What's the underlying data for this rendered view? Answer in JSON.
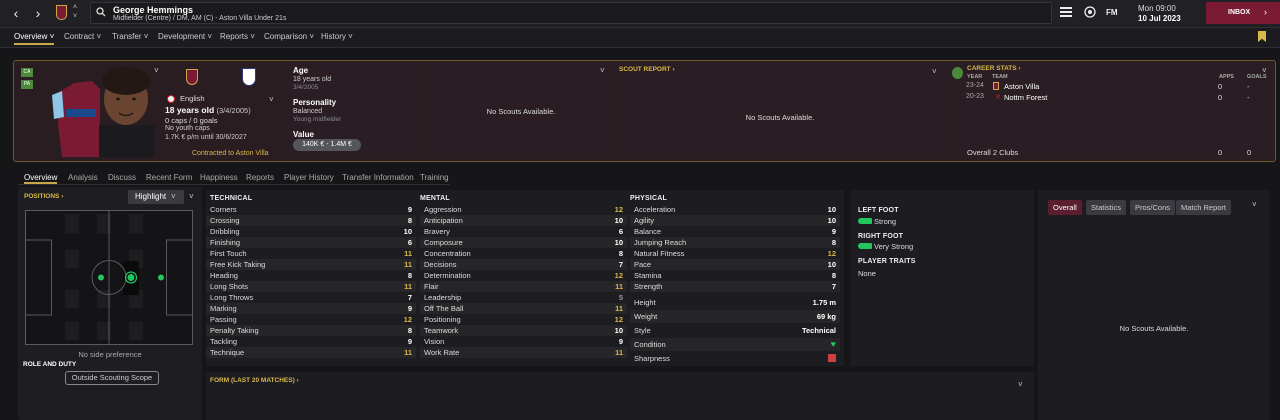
{
  "topbar": {
    "player_name": "George Hemmings",
    "player_subtitle": "Midfielder (Centre) / DM, AM (C) - Aston Villa Under 21s",
    "fm_label": "FM",
    "date_day": "Mon 09:00",
    "date": "10 Jul 2023",
    "inbox_label": "INBOX",
    "accent_color": "#7a1b33"
  },
  "menu": [
    {
      "label": "Overview"
    },
    {
      "label": "Contract"
    },
    {
      "label": "Transfer"
    },
    {
      "label": "Development"
    },
    {
      "label": "Reports"
    },
    {
      "label": "Comparison"
    },
    {
      "label": "History"
    }
  ],
  "profile": {
    "badge_a": "CA",
    "badge_b": "PA",
    "nationality": "English",
    "age_line": "18 years old",
    "dob_paren": "(3/4/2005)",
    "caps_line": "0 caps / 0 goals",
    "youth_caps": "No youth caps",
    "wage": "1.7K € p/m until 30/6/2027",
    "contract_note": "Contracted to Aston Villa",
    "age_label": "Age",
    "age_value": "18 years old",
    "dob": "3/4/2005",
    "personality_label": "Personality",
    "personality": "Balanced",
    "personality_sub": "Young midfielder",
    "value_label": "Value",
    "value": "140K € - 1.4M €"
  },
  "scouts": {
    "no_scouts": "No Scouts Available.",
    "scout_report_link": "SCOUT REPORT",
    "no_scouts2": "No Scouts Available."
  },
  "career": {
    "title": "CAREER STATS",
    "col_year": "YEAR",
    "col_team": "TEAM",
    "col_apps": "APPS",
    "col_goals": "GOALS",
    "rows": [
      {
        "year": "23-24",
        "team": "Aston Villa",
        "apps": "0",
        "goals": "-"
      },
      {
        "year": "20-23",
        "team": "Nottm Forest",
        "apps": "0",
        "goals": "-"
      }
    ],
    "overall_label": "Overall 2 Clubs",
    "overall_apps": "0",
    "overall_goals": "0"
  },
  "tabs": [
    {
      "label": "Overview"
    },
    {
      "label": "Analysis"
    },
    {
      "label": "Discuss"
    },
    {
      "label": "Recent Form"
    },
    {
      "label": "Happiness"
    },
    {
      "label": "Reports"
    },
    {
      "label": "Player History"
    },
    {
      "label": "Transfer Information"
    },
    {
      "label": "Training"
    }
  ],
  "positions": {
    "link": "POSITIONS",
    "dropdown": "Highlight",
    "no_side": "No side preference",
    "role_duty": "ROLE AND DUTY",
    "scope_button": "Outside Scouting Scope"
  },
  "attributes": {
    "technical_title": "TECHNICAL",
    "technical": [
      {
        "name": "Corners",
        "value": "9"
      },
      {
        "name": "Crossing",
        "value": "8"
      },
      {
        "name": "Dribbling",
        "value": "10"
      },
      {
        "name": "Finishing",
        "value": "6"
      },
      {
        "name": "First Touch",
        "value": "11"
      },
      {
        "name": "Free Kick Taking",
        "value": "11"
      },
      {
        "name": "Heading",
        "value": "8"
      },
      {
        "name": "Long Shots",
        "value": "11"
      },
      {
        "name": "Long Throws",
        "value": "7"
      },
      {
        "name": "Marking",
        "value": "9"
      },
      {
        "name": "Passing",
        "value": "12"
      },
      {
        "name": "Penalty Taking",
        "value": "8"
      },
      {
        "name": "Tackling",
        "value": "9"
      },
      {
        "name": "Technique",
        "value": "11"
      }
    ],
    "mental_title": "MENTAL",
    "mental": [
      {
        "name": "Aggression",
        "value": "12"
      },
      {
        "name": "Anticipation",
        "value": "10"
      },
      {
        "name": "Bravery",
        "value": "6"
      },
      {
        "name": "Composure",
        "value": "10"
      },
      {
        "name": "Concentration",
        "value": "8"
      },
      {
        "name": "Decisions",
        "value": "7"
      },
      {
        "name": "Determination",
        "value": "12"
      },
      {
        "name": "Flair",
        "value": "11"
      },
      {
        "name": "Leadership",
        "value": "5"
      },
      {
        "name": "Off The Ball",
        "value": "11"
      },
      {
        "name": "Positioning",
        "value": "12"
      },
      {
        "name": "Teamwork",
        "value": "10"
      },
      {
        "name": "Vision",
        "value": "9"
      },
      {
        "name": "Work Rate",
        "value": "11"
      }
    ],
    "physical_title": "PHYSICAL",
    "physical": [
      {
        "name": "Acceleration",
        "value": "10"
      },
      {
        "name": "Agility",
        "value": "10"
      },
      {
        "name": "Balance",
        "value": "9"
      },
      {
        "name": "Jumping Reach",
        "value": "8"
      },
      {
        "name": "Natural Fitness",
        "value": "12"
      },
      {
        "name": "Pace",
        "value": "10"
      },
      {
        "name": "Stamina",
        "value": "8"
      },
      {
        "name": "Strength",
        "value": "7"
      }
    ],
    "extra": [
      {
        "name": "Height",
        "value": "1.75 m"
      },
      {
        "name": "Weight",
        "value": "69 kg"
      },
      {
        "name": "Style",
        "value": "Technical"
      },
      {
        "name": "Condition",
        "value": ""
      },
      {
        "name": "Sharpness",
        "value": ""
      }
    ]
  },
  "feet": {
    "left_title": "LEFT FOOT",
    "left_value": "Strong",
    "right_title": "RIGHT FOOT",
    "right_value": "Very Strong",
    "traits_title": "PLAYER TRAITS",
    "traits_value": "None"
  },
  "form": {
    "title": "FORM (LAST 20 MATCHES)"
  },
  "right_panel": {
    "chips": [
      "Overall",
      "Statistics",
      "Pros/Cons",
      "Match Report"
    ],
    "no_scouts": "No Scouts Available."
  }
}
